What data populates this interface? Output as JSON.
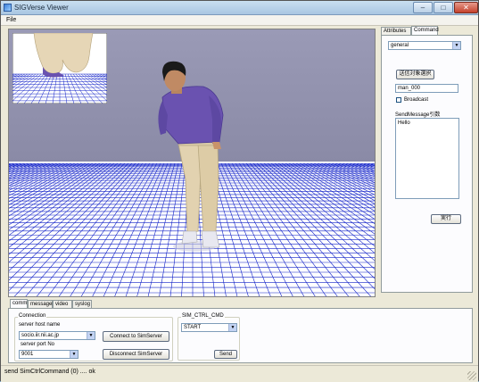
{
  "window": {
    "title": "SIGVerse Viewer"
  },
  "menu": {
    "file": "File"
  },
  "side": {
    "tabs": [
      "Attributes",
      "Command"
    ],
    "mode_select": "general",
    "select_target_button": "送信対象選択",
    "target_value": "man_000",
    "broadcast_label": "Broadcast",
    "sendmessage_label": "SendMessage引数",
    "message_value": "Hello",
    "execute_button": "実行"
  },
  "bottom": {
    "tabs": [
      "comm",
      "messages",
      "video",
      "syslog"
    ],
    "connection_group": "Connection",
    "host_label": "server host name",
    "host_value": "socio.iir.nii.ac.jp",
    "port_label": "server port No",
    "port_value": "9001",
    "connect_button": "Connect to SimServer",
    "disconnect_button": "Disconnect SimServer",
    "simctrl_group": "SIM_CTRL_CMD",
    "simctrl_value": "START",
    "send_button": "Send"
  },
  "status": {
    "text": "send SimCtrlCommand (0) .... ok"
  },
  "colors": {
    "sky": "#8e8ea8",
    "floor": "#ffffff",
    "grid": "#1020c8",
    "shirt": "#6a52b0",
    "pants": "#e2d2b0"
  }
}
